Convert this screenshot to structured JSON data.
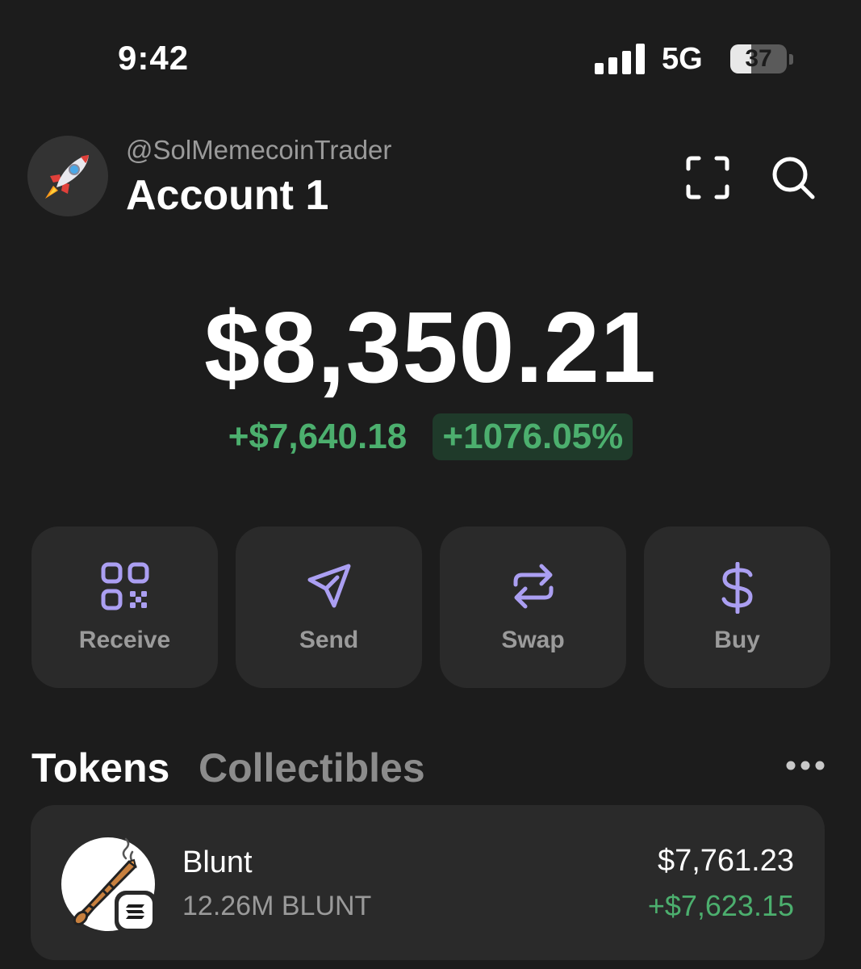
{
  "status_bar": {
    "time": "9:42",
    "network": "5G",
    "battery_level": "37"
  },
  "header": {
    "handle": "@SolMemecoinTrader",
    "account_name": "Account 1",
    "avatar_icon": "rocket-icon",
    "icons": [
      "scan-icon",
      "search-icon"
    ]
  },
  "balance": {
    "total": "$8,350.21",
    "change_amount": "+$7,640.18",
    "change_percent": "+1076.05%"
  },
  "actions": [
    {
      "label": "Receive",
      "icon": "qr-code-icon"
    },
    {
      "label": "Send",
      "icon": "send-icon"
    },
    {
      "label": "Swap",
      "icon": "swap-icon"
    },
    {
      "label": "Buy",
      "icon": "dollar-icon"
    }
  ],
  "tabs": {
    "tokens": "Tokens",
    "collectibles": "Collectibles",
    "active": "Tokens"
  },
  "tokens": [
    {
      "name": "Blunt",
      "amount": "12.26M BLUNT",
      "value": "$7,761.23",
      "change": "+$7,623.15",
      "chain": "solana"
    }
  ],
  "colors": {
    "background": "#1c1c1c",
    "card": "#2a2a2a",
    "accent": "#ab9ff2",
    "positive": "#4caf6e",
    "positive_bg": "#1f3a2a",
    "muted_text": "#9a9a9a"
  }
}
